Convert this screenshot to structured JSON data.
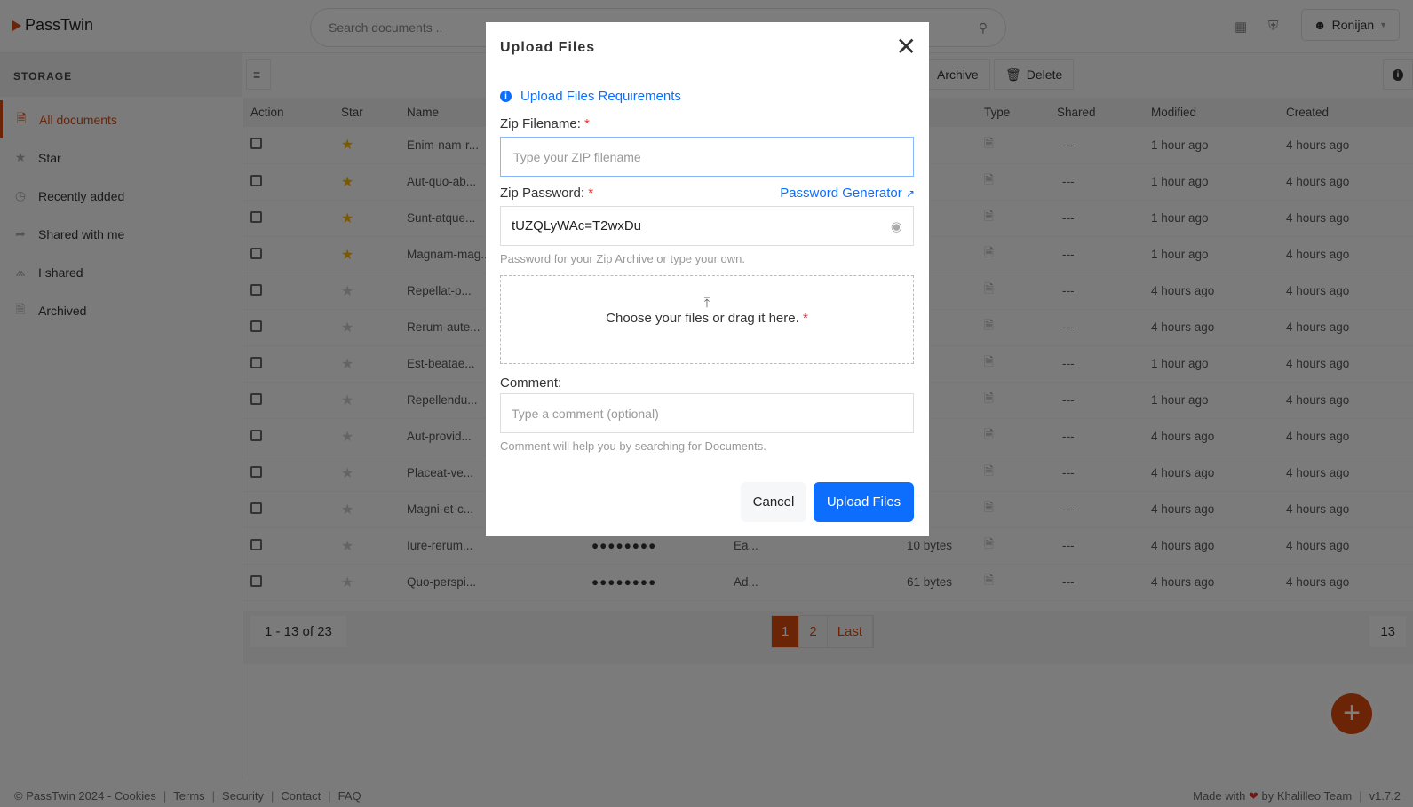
{
  "app": {
    "name": "PassTwin"
  },
  "header": {
    "search_placeholder": "Search documents ..",
    "user": "Ronijan",
    "icons": [
      "grid-icon",
      "shield-icon",
      "search-icon"
    ]
  },
  "sidebar": {
    "heading": "STORAGE",
    "items": [
      {
        "label": "All documents",
        "icon": "file-icon",
        "active": true
      },
      {
        "label": "Star",
        "icon": "star-icon"
      },
      {
        "label": "Recently added",
        "icon": "clock-icon"
      },
      {
        "label": "Shared with me",
        "icon": "share-icon"
      },
      {
        "label": "I shared",
        "icon": "share-nodes-icon"
      },
      {
        "label": "Archived",
        "icon": "archive-icon"
      }
    ]
  },
  "toolbar": {
    "archive": "Archive",
    "delete": "Delete"
  },
  "table": {
    "headers": {
      "action": "Action",
      "star": "Star",
      "name": "Name",
      "type": "Type",
      "shared": "Shared",
      "modified": "Modified",
      "created": "Created"
    },
    "rows": [
      {
        "name": "Enim-nam-r...",
        "starred": true,
        "shared": "---",
        "modified": "1 hour ago",
        "created": "4 hours ago"
      },
      {
        "name": "Aut-quo-ab...",
        "starred": true,
        "shared": "---",
        "modified": "1 hour ago",
        "created": "4 hours ago"
      },
      {
        "name": "Sunt-atque...",
        "starred": true,
        "shared": "---",
        "modified": "1 hour ago",
        "created": "4 hours ago"
      },
      {
        "name": "Magnam-mag...",
        "starred": true,
        "shared": "---",
        "modified": "1 hour ago",
        "created": "4 hours ago"
      },
      {
        "name": "Repellat-p...",
        "starred": false,
        "shared": "---",
        "modified": "4 hours ago",
        "created": "4 hours ago"
      },
      {
        "name": "Rerum-aute...",
        "starred": false,
        "shared": "---",
        "modified": "4 hours ago",
        "created": "4 hours ago"
      },
      {
        "name": "Est-beatae...",
        "starred": false,
        "shared": "---",
        "modified": "1 hour ago",
        "created": "4 hours ago"
      },
      {
        "name": "Repellendu...",
        "starred": false,
        "shared": "---",
        "modified": "1 hour ago",
        "created": "4 hours ago"
      },
      {
        "name": "Aut-provid...",
        "starred": false,
        "shared": "---",
        "modified": "4 hours ago",
        "created": "4 hours ago"
      },
      {
        "name": "Placeat-ve...",
        "starred": false,
        "shared": "---",
        "modified": "4 hours ago",
        "created": "4 hours ago"
      },
      {
        "name": "Magni-et-c...",
        "starred": false,
        "shared": "---",
        "modified": "4 hours ago",
        "created": "4 hours ago"
      },
      {
        "name": "Iure-rerum...",
        "starred": false,
        "password": "●●●●●●●●",
        "description": "Ea...",
        "size": "10 bytes",
        "shared": "---",
        "modified": "4 hours ago",
        "created": "4 hours ago"
      },
      {
        "name": "Quo-perspi...",
        "starred": false,
        "password": "●●●●●●●●",
        "description": "Ad...",
        "size": "61 bytes",
        "shared": "---",
        "modified": "4 hours ago",
        "created": "4 hours ago"
      }
    ]
  },
  "pagination": {
    "summary": "1 - 13 of 23",
    "pages": [
      "1",
      "2",
      "Last"
    ],
    "current": "1",
    "per_page": "13"
  },
  "footer": {
    "left": [
      "© PassTwin 2024 - Cookies",
      "Terms",
      "Security",
      "Contact",
      "FAQ"
    ],
    "made_with": "Made with",
    "by": "by Khalilleo Team",
    "version": "v1.7.2"
  },
  "modal": {
    "title": "Upload Files",
    "requirements_link": "Upload Files Requirements",
    "zip_filename_label": "Zip Filename:",
    "zip_filename_placeholder": "Type your ZIP filename",
    "zip_password_label": "Zip Password:",
    "password_generator": "Password Generator",
    "zip_password_value": "tUZQLyWAc=T2wxDu",
    "password_help": "Password for your Zip Archive or type your own.",
    "dropzone_text": "Choose your files or drag it here.",
    "required_mark": "*",
    "comment_label": "Comment:",
    "comment_placeholder": "Type a comment (optional)",
    "comment_help": "Comment will help you by searching for Documents.",
    "cancel": "Cancel",
    "submit": "Upload Files"
  },
  "colors": {
    "accent": "#d9480f",
    "primary": "#0d6efd",
    "star": "#f5b301"
  }
}
